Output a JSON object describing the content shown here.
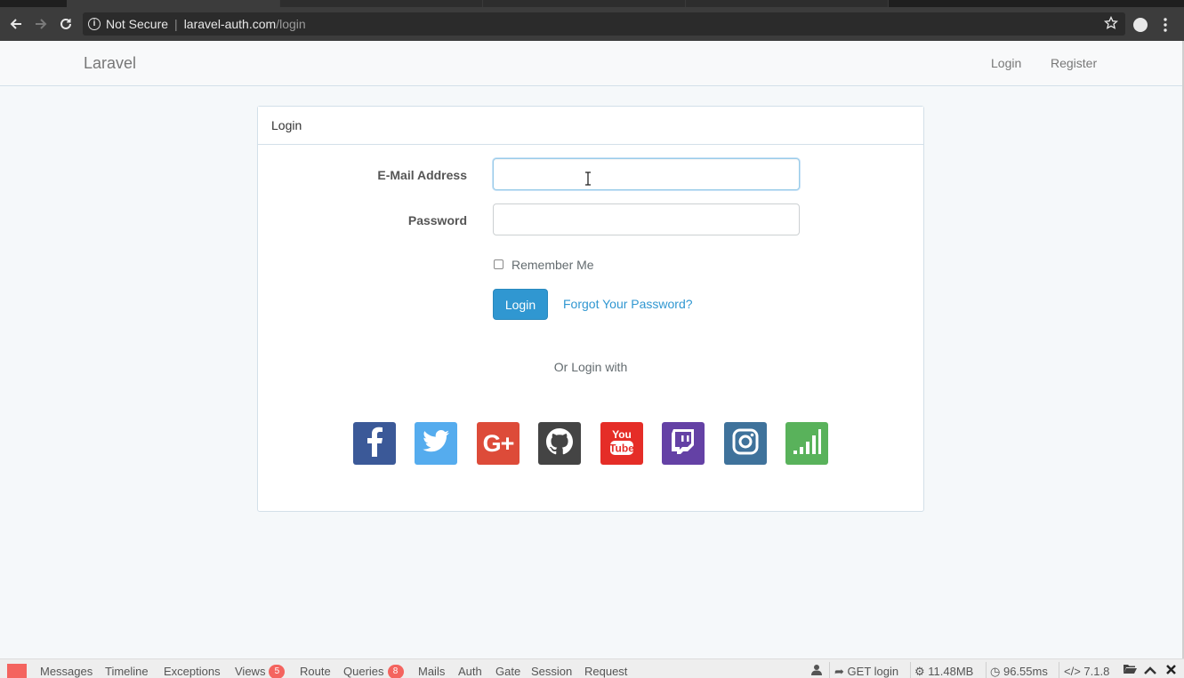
{
  "browser": {
    "security_label": "Not Secure",
    "url_host": "laravel-auth.com",
    "url_path": "/login"
  },
  "navbar": {
    "brand": "Laravel",
    "login": "Login",
    "register": "Register"
  },
  "panel": {
    "heading": "Login",
    "email_label": "E-Mail Address",
    "email_value": "",
    "password_label": "Password",
    "password_value": "",
    "remember_label": "Remember Me",
    "login_button": "Login",
    "forgot_link": "Forgot Your Password?",
    "or_login_with": "Or Login with"
  },
  "social_buttons": [
    {
      "name": "facebook",
      "color": "#3b5998"
    },
    {
      "name": "twitter",
      "color": "#55acee"
    },
    {
      "name": "google-plus",
      "color": "#dd4b39"
    },
    {
      "name": "github",
      "color": "#444444"
    },
    {
      "name": "youtube",
      "color": "#e52d27"
    },
    {
      "name": "twitch",
      "color": "#6441a5"
    },
    {
      "name": "instagram",
      "color": "#3f729b"
    },
    {
      "name": "37signals",
      "color": "#59b25b"
    }
  ],
  "debugbar": {
    "messages": "Messages",
    "timeline": "Timeline",
    "exceptions": "Exceptions",
    "views": "Views",
    "views_count": "5",
    "route": "Route",
    "queries": "Queries",
    "queries_count": "8",
    "mails": "Mails",
    "auth": "Auth",
    "gate": "Gate",
    "session": "Session",
    "request": "Request",
    "method_route": "GET login",
    "memory": "11.48MB",
    "time": "96.55ms",
    "php_version": "7.1.8"
  }
}
